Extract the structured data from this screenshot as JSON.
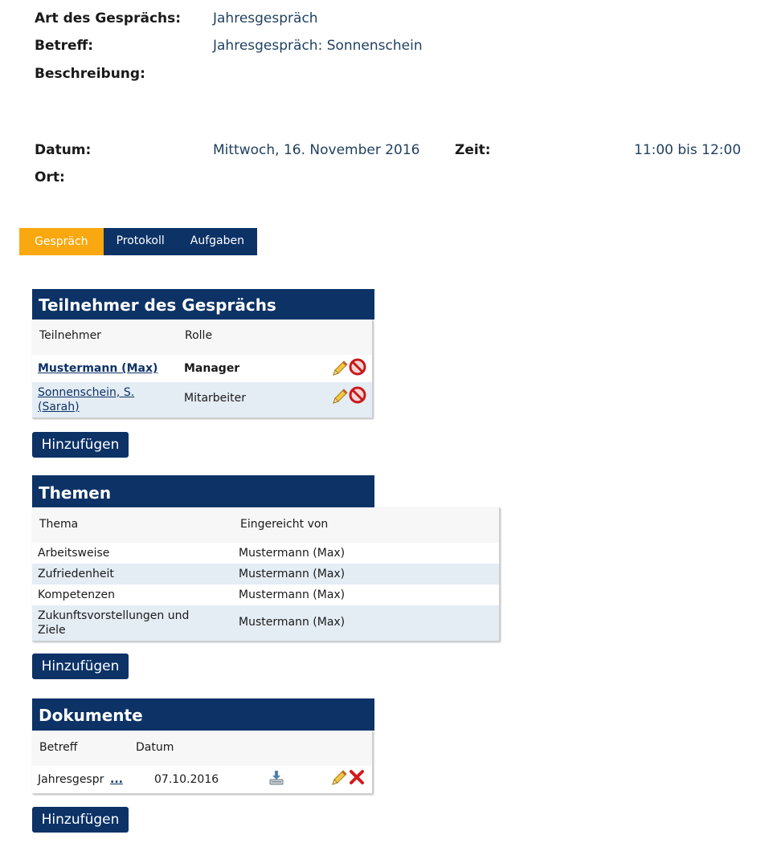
{
  "details": {
    "art_label": "Art des Gesprächs:",
    "art_value": "Jahresgespräch",
    "betreff_label": "Betreff:",
    "betreff_value": "Jahresgespräch: Sonnenschein",
    "beschreibung_label": "Beschreibung:",
    "datum_label": "Datum:",
    "datum_value": "Mittwoch, 16. November 2016",
    "zeit_label": "Zeit:",
    "zeit_value": "11:00 bis 12:00",
    "ort_label": "Ort:"
  },
  "tabs": [
    {
      "label": "Gespräch",
      "active": true
    },
    {
      "label": "Protokoll",
      "active": false
    },
    {
      "label": "Aufgaben",
      "active": false
    }
  ],
  "teilnehmer": {
    "title": "Teilnehmer des Gesprächs",
    "col_teilnehmer": "Teilnehmer",
    "col_rolle": "Rolle",
    "rows": [
      {
        "name": "Mustermann (Max)",
        "rolle": "Manager"
      },
      {
        "name_line1": "Sonnenschein, S.",
        "name_line2": "(Sarah)",
        "rolle": "Mitarbeiter"
      }
    ],
    "add_label": "Hinzufügen"
  },
  "themen": {
    "title": "Themen",
    "col_thema": "Thema",
    "col_eingereicht": "Eingereicht von",
    "rows": [
      {
        "thema": "Arbeitsweise",
        "von": "Mustermann (Max)"
      },
      {
        "thema": "Zufriedenheit",
        "von": "Mustermann (Max)"
      },
      {
        "thema": "Kompetenzen",
        "von": "Mustermann (Max)"
      },
      {
        "thema_line1": "Zukunftsvorstellungen und",
        "thema_line2": "Ziele",
        "von": "Mustermann (Max)"
      }
    ],
    "add_label": "Hinzufügen"
  },
  "dokumente": {
    "title": "Dokumente",
    "col_betreff": "Betreff",
    "col_datum": "Datum",
    "rows": [
      {
        "betreff": "Jahresgespr",
        "more": "...",
        "datum": "07.10.2016"
      }
    ],
    "add_label": "Hinzufügen"
  },
  "colors": {
    "primary": "#0c3266",
    "active_tab": "#f9a80f",
    "value_text": "#1f3f5f",
    "row_alt": "#e4ecf4"
  },
  "icons": [
    "pencil-icon",
    "delete-circle-icon",
    "download-icon",
    "delete-x-icon"
  ]
}
